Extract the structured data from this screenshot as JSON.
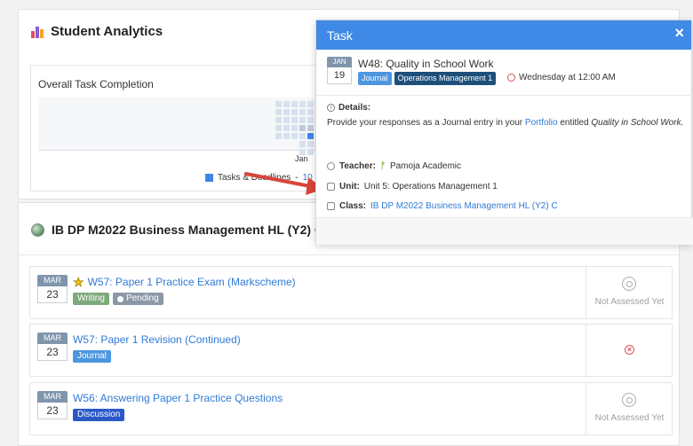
{
  "analytics": {
    "title": "Student Analytics",
    "chart_title": "Overall Task Completion",
    "month_label": "Jan",
    "legend_label": "Tasks & Deadlines",
    "legend_separator": "-",
    "legend_count": "10",
    "colors": {
      "completed": "#3f86e8",
      "empty": "#d6e1ef"
    }
  },
  "course": {
    "title": "IB DP M2022 Business Management HL (Y2) C"
  },
  "tasks": [
    {
      "month": "MAR",
      "day": "23",
      "starred": true,
      "title": "W57: Paper 1 Practice Exam (Markscheme)",
      "tags": [
        "Writing",
        "Pending"
      ],
      "status": "Not Assessed Yet"
    },
    {
      "month": "MAR",
      "day": "23",
      "starred": false,
      "title": "W57: Paper 1 Revision (Continued)",
      "tags": [
        "Journal"
      ],
      "status": ""
    },
    {
      "month": "MAR",
      "day": "23",
      "starred": false,
      "title": "W56: Answering Paper 1 Practice Questions",
      "tags": [
        "Discussion"
      ],
      "status": "Not Assessed Yet"
    }
  ],
  "modal": {
    "header": "Task",
    "close_icon": "×",
    "month": "JAN",
    "day": "19",
    "title": "W48: Quality in School Work",
    "tags": [
      "Journal",
      "Operations Management 1"
    ],
    "due": "Wednesday at 12:00 AM",
    "details_label": "Details:",
    "details_prefix": "Provide your responses as a Journal entry in your",
    "details_link": "Portfolio",
    "details_middle": "entitled",
    "details_italic": "Quality in School Work.",
    "teacher_label": "Teacher:",
    "teacher_value": "Pamoja Academic",
    "unit_label": "Unit:",
    "unit_value": "Unit 5: Operations Management 1",
    "class_label": "Class:",
    "class_value": "IB DP M2022 Business Management HL (Y2) C"
  }
}
